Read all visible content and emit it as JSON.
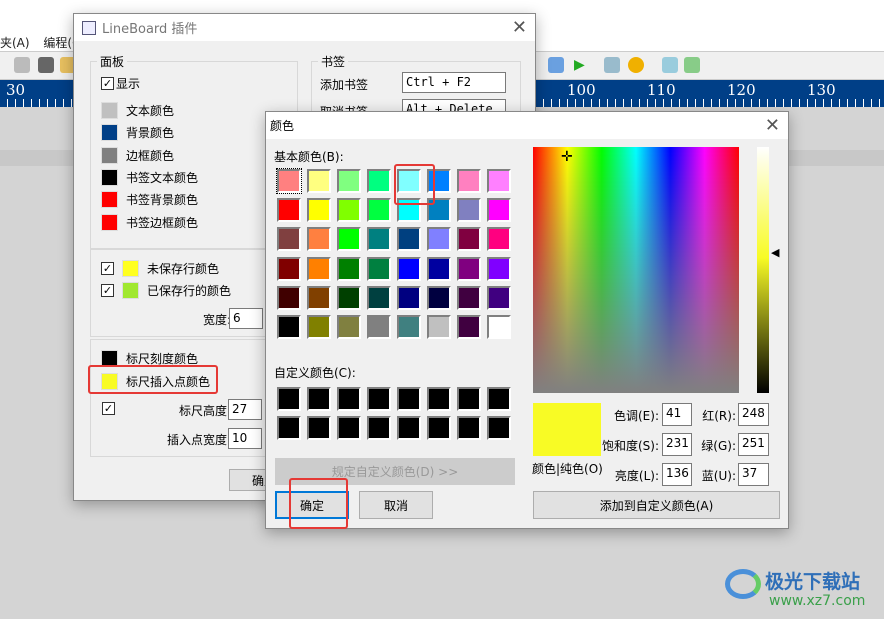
{
  "app": {
    "menu": [
      "夹(A)",
      "编程(C)"
    ],
    "ruler_labels": [
      "30",
      "100",
      "110",
      "120",
      "130"
    ]
  },
  "lineboard": {
    "title": "LineBoard 插件",
    "panel": {
      "label": "面板",
      "show_label": "显示",
      "show_checked": true,
      "colors": [
        {
          "label": "文本颜色",
          "color": "#c0c0c0"
        },
        {
          "label": "背景颜色",
          "color": "#003f87"
        },
        {
          "label": "边框颜色",
          "color": "#808080"
        },
        {
          "label": "书签文本颜色",
          "color": "#000000"
        },
        {
          "label": "书签背景颜色",
          "color": "#ff0000"
        },
        {
          "label": "书签边框颜色",
          "color": "#ff0000"
        }
      ]
    },
    "lines": {
      "unsaved_label": "未保存行颜色",
      "unsaved_color": "#ffff20",
      "unsaved_checked": true,
      "saved_label": "已保存行的颜色",
      "saved_color": "#a0e830",
      "saved_checked": true,
      "width_label": "宽度:",
      "width_value": "6"
    },
    "ruler": {
      "tick_label": "标尺刻度颜色",
      "tick_color": "#000000",
      "insert_label": "标尺插入点颜色",
      "insert_color": "#f8fb25",
      "height_label": "标尺高度:",
      "height_value": "27",
      "height_checked": true,
      "insert_width_label": "插入点宽度:",
      "insert_width_value": "10"
    },
    "bookmark": {
      "label": "书签",
      "add_label": "添加书签",
      "add_value": "Ctrl + F2",
      "remove_label": "取消书签",
      "remove_value": "Alt + Delete"
    },
    "ok_label": "确定"
  },
  "color_dialog": {
    "title": "颜色",
    "basic_label": "基本颜色(B):",
    "basic_colors": [
      [
        "#FF8080",
        "#FFFF80",
        "#80FF80",
        "#00FF80",
        "#80FFFF",
        "#0080FF",
        "#FF80C0",
        "#FF80FF"
      ],
      [
        "#FF0000",
        "#FFFF00",
        "#80FF00",
        "#00FF40",
        "#00FFFF",
        "#0080C0",
        "#8080C0",
        "#FF00FF"
      ],
      [
        "#804040",
        "#FF8040",
        "#00FF00",
        "#008080",
        "#004080",
        "#8080FF",
        "#800040",
        "#FF0080"
      ],
      [
        "#800000",
        "#FF8000",
        "#008000",
        "#008040",
        "#0000FF",
        "#0000A0",
        "#800080",
        "#8000FF"
      ],
      [
        "#400000",
        "#804000",
        "#004000",
        "#004040",
        "#000080",
        "#000040",
        "#400040",
        "#400080"
      ],
      [
        "#000000",
        "#808000",
        "#808040",
        "#808080",
        "#408080",
        "#C0C0C0",
        "#400040",
        "#FFFFFF"
      ]
    ],
    "custom_label": "自定义颜色(C):",
    "define_custom_label": "规定自定义颜色(D) >>",
    "ok_label": "确定",
    "cancel_label": "取消",
    "preview_color": "#f8fb25",
    "preview_label": "颜色|纯色(O)",
    "hue_label": "色调(E):",
    "hue": "41",
    "sat_label": "饱和度(S):",
    "sat": "231",
    "lum_label": "亮度(L):",
    "lum": "136",
    "red_label": "红(R):",
    "red": "248",
    "green_label": "绿(G):",
    "green": "251",
    "blue_label": "蓝(U):",
    "blue": "37",
    "add_custom_label": "添加到自定义颜色(A)"
  },
  "watermark": {
    "text": "极光下载站",
    "url": "www.xz7.com"
  }
}
